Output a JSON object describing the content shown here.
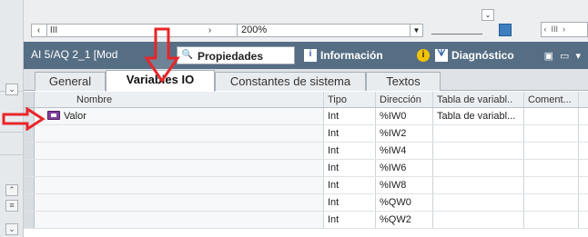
{
  "toolbar": {
    "zoom_value": "200%",
    "scroll_left_glyph": "‹",
    "scroll_right_glyph": "›",
    "scroll_thumb_glyph": "III",
    "dropdown_glyph": "▼"
  },
  "inspector": {
    "title": "AI 5/AQ 2_1 [Mod",
    "tabs": [
      {
        "label": "Propiedades",
        "icon": "properties-icon",
        "active": true
      },
      {
        "label": "Información",
        "icon": "info-icon",
        "active": false
      },
      {
        "label": "Diagnóstico",
        "icon": "diagnostics-icon",
        "active": false
      }
    ],
    "info_badge": "i"
  },
  "subtabs": [
    {
      "label": "General",
      "active": false
    },
    {
      "label": "Variables IO",
      "active": true
    },
    {
      "label": "Constantes de sistema",
      "active": false
    },
    {
      "label": "Textos",
      "active": false
    }
  ],
  "table": {
    "headers": {
      "name": "Nombre",
      "tipo": "Tipo",
      "direccion": "Dirección",
      "tabla": "Tabla de variabl..",
      "comentario": "Coment..."
    },
    "rows": [
      {
        "name": "Valor",
        "tipo": "Int",
        "direccion": "%IW0",
        "tabla": "Tabla de variabl...",
        "comentario": ""
      },
      {
        "name": "",
        "tipo": "Int",
        "direccion": "%IW2",
        "tabla": "",
        "comentario": ""
      },
      {
        "name": "",
        "tipo": "Int",
        "direccion": "%IW4",
        "tabla": "",
        "comentario": ""
      },
      {
        "name": "",
        "tipo": "Int",
        "direccion": "%IW6",
        "tabla": "",
        "comentario": ""
      },
      {
        "name": "",
        "tipo": "Int",
        "direccion": "%IW8",
        "tabla": "",
        "comentario": ""
      },
      {
        "name": "",
        "tipo": "Int",
        "direccion": "%QW0",
        "tabla": "",
        "comentario": ""
      },
      {
        "name": "",
        "tipo": "Int",
        "direccion": "%QW2",
        "tabla": "",
        "comentario": ""
      }
    ]
  },
  "colors": {
    "inspector_bar": "#566e84",
    "annotation_arrow": "#e8262a",
    "tag_icon": "#7f3f9a"
  }
}
